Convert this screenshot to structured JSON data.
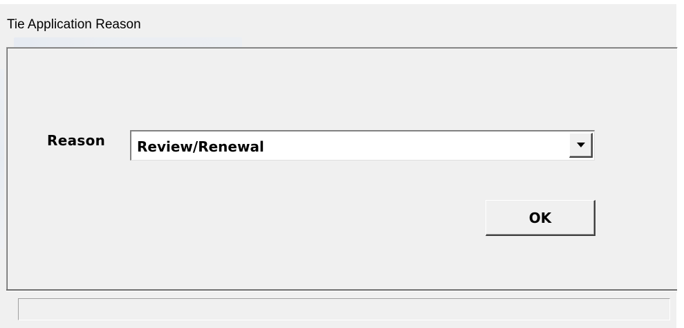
{
  "window": {
    "title": "Tie Application Reason"
  },
  "form": {
    "reason_label": "Reason",
    "reason_value": "Review/Renewal",
    "ok_label": "OK"
  },
  "status_bar": {
    "text": ""
  },
  "colors": {
    "window_bg": "#f0f0f0",
    "field_bg": "#ffffff",
    "border_dark": "#404040",
    "border_mid": "#808080"
  },
  "icons": {
    "dropdown": "chevron-down-icon"
  }
}
